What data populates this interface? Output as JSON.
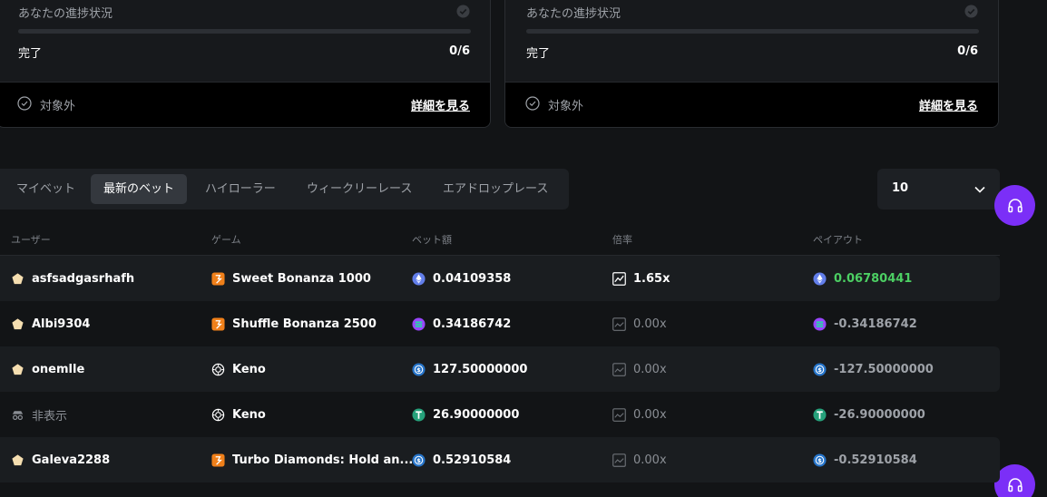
{
  "progress_cards": [
    {
      "title": "あなたの進捗状況",
      "progress_fraction": 0,
      "done_label": "完了",
      "done_count": "0/6",
      "status": "対象外",
      "details_link": "詳細を見る"
    },
    {
      "title": "あなたの進捗状況",
      "progress_fraction": 0,
      "done_label": "完了",
      "done_count": "0/6",
      "status": "対象外",
      "details_link": "詳細を見る"
    }
  ],
  "tabs": [
    {
      "label": "マイベット",
      "active": false
    },
    {
      "label": "最新のベット",
      "active": true
    },
    {
      "label": "ハイローラー",
      "active": false
    },
    {
      "label": "ウィークリーレース",
      "active": false
    },
    {
      "label": "エアドロップレース",
      "active": false
    }
  ],
  "page_size": {
    "value": "10",
    "icon": "chevron-down-icon"
  },
  "table": {
    "headers": [
      "ユーザー",
      "ゲーム",
      "ベット額",
      "倍率",
      "ペイアウト"
    ],
    "rows": [
      {
        "user": "asfsadgasrhafh",
        "user_icon": "pentagon-badge-icon",
        "user_hidden": false,
        "game": "Sweet Bonanza 1000",
        "game_icon": "slot-icon",
        "bet": "0.04109358",
        "currency_icon": "eth-icon",
        "multiplier": "1.65x",
        "multiplier_win": true,
        "payout": "0.06780441",
        "payout_win": true
      },
      {
        "user": "Albi9304",
        "user_icon": "pentagon-badge-icon",
        "user_hidden": false,
        "game": "Shuffle Bonanza 2500",
        "game_icon": "slot-icon",
        "bet": "0.34186742",
        "currency_icon": "sol-icon",
        "multiplier": "0.00x",
        "multiplier_win": false,
        "payout": "-0.34186742",
        "payout_win": false
      },
      {
        "user": "onemlle",
        "user_icon": "pentagon-badge-icon",
        "user_hidden": false,
        "game": "Keno",
        "game_icon": "keno-icon",
        "bet": "127.50000000",
        "currency_icon": "usdc-icon",
        "multiplier": "0.00x",
        "multiplier_win": false,
        "payout": "-127.50000000",
        "payout_win": false
      },
      {
        "user": "非表示",
        "user_icon": "incognito-icon",
        "user_hidden": true,
        "game": "Keno",
        "game_icon": "keno-icon",
        "bet": "26.90000000",
        "currency_icon": "usdt-icon",
        "multiplier": "0.00x",
        "multiplier_win": false,
        "payout": "-26.90000000",
        "payout_win": false
      },
      {
        "user": "Galeva2288",
        "user_icon": "pentagon-badge-icon",
        "user_hidden": false,
        "game": "Turbo Diamonds: Hold an...",
        "game_icon": "slot-icon",
        "bet": "0.52910584",
        "currency_icon": "usdc-icon",
        "multiplier": "0.00x",
        "multiplier_win": false,
        "payout": "-0.52910584",
        "payout_win": false
      }
    ]
  },
  "colors": {
    "background": "#121416",
    "panel": "#1d2024",
    "accent_purple": "#7b2ff7",
    "win_green": "#4ccf63",
    "muted_text": "#9ea2a8"
  },
  "support_button_icon": "headphones-icon"
}
